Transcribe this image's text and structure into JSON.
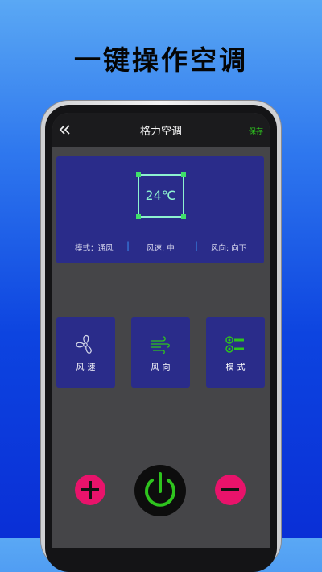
{
  "promo": {
    "headline": "一键操作空调"
  },
  "navbar": {
    "title": "格力空调",
    "save_label": "保存",
    "back_icon": "double-chevron-left-icon"
  },
  "display": {
    "temperature": "24℃",
    "mode_status": "模式：通风",
    "wind_speed_status": "风速: 中",
    "wind_direction_status": "风向: 向下",
    "separator": "|"
  },
  "controls": [
    {
      "label": "风速",
      "icon": "fan-icon"
    },
    {
      "label": "风向",
      "icon": "wind-direction-icon"
    },
    {
      "label": "模式",
      "icon": "mode-icon"
    }
  ],
  "bottom": {
    "plus_icon": "plus-icon",
    "power_icon": "power-icon",
    "minus_icon": "minus-icon"
  },
  "colors": {
    "accent_green": "#2ec41e",
    "card_blue": "#2a2c8a",
    "pink": "#e8136b",
    "teal": "#8ef2d0"
  }
}
